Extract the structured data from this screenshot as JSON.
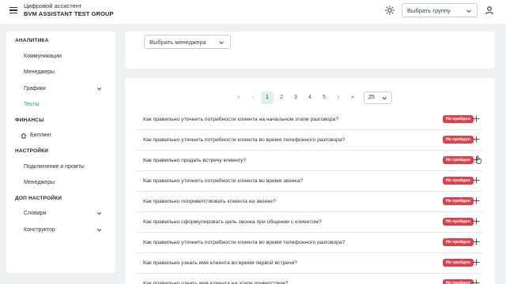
{
  "header": {
    "app_title": "Цифровой ассистент",
    "group_name": "BVM ASSISTANT TEST GROUP",
    "group_select_placeholder": "Выбрать группу"
  },
  "sidebar": {
    "sections": [
      {
        "title": "АНАЛИТИКА"
      },
      {
        "title": "ФИНАНСЫ"
      },
      {
        "title": "НАСТРОЙКИ"
      },
      {
        "title": "ДОП НАСТРОЙКИ"
      }
    ],
    "items": [
      {
        "label": "Коммуникации"
      },
      {
        "label": "Менеджеры"
      },
      {
        "label": "Графики"
      },
      {
        "label": "Тесты"
      },
      {
        "label": "Биллинг"
      },
      {
        "label": "Подключение и промты"
      },
      {
        "label": "Менеджеры"
      },
      {
        "label": "Словари"
      },
      {
        "label": "Конструктор"
      }
    ],
    "active_item": "Тесты",
    "accent_color": "#2a9d63"
  },
  "filters": {
    "manager_select_placeholder": "Выбрать менеджера"
  },
  "pagination": {
    "first": "«",
    "prev": "‹",
    "pages": [
      "1",
      "2",
      "3",
      "4",
      "5"
    ],
    "current_page": "1",
    "next": "›",
    "last": "»",
    "per_page": "25"
  },
  "tests": {
    "status_color": "#d9434b",
    "rows": [
      {
        "question": "Как правильно уточнить потребности клиента на начальном этапе разговора?",
        "status": "Не пройден"
      },
      {
        "question": "Как правильно уточнить потребности клиента во время телефонного разговора?",
        "status": "Не пройден"
      },
      {
        "question": "Как правильно продать встречу клиенту?",
        "status": "Не пройден"
      },
      {
        "question": "Как правильно уточнить потребности клиента во время звонка?",
        "status": "Не пройден"
      },
      {
        "question": "Как правильно поприветствовать клиента на звонке?",
        "status": "Не пройден"
      },
      {
        "question": "Как правильно сформулировать цель звонка при общении с клиентом?",
        "status": "Не пройден"
      },
      {
        "question": "Как правильно уточнить потребности клиента во время телефонного разговора?",
        "status": "Не пройден"
      },
      {
        "question": "Как правильно узнать имя клиента во время первой встречи?",
        "status": "Не пройден"
      },
      {
        "question": "Как правильно узнать имя клиента на этапе приветствия?",
        "status": "Не пройден"
      }
    ]
  }
}
